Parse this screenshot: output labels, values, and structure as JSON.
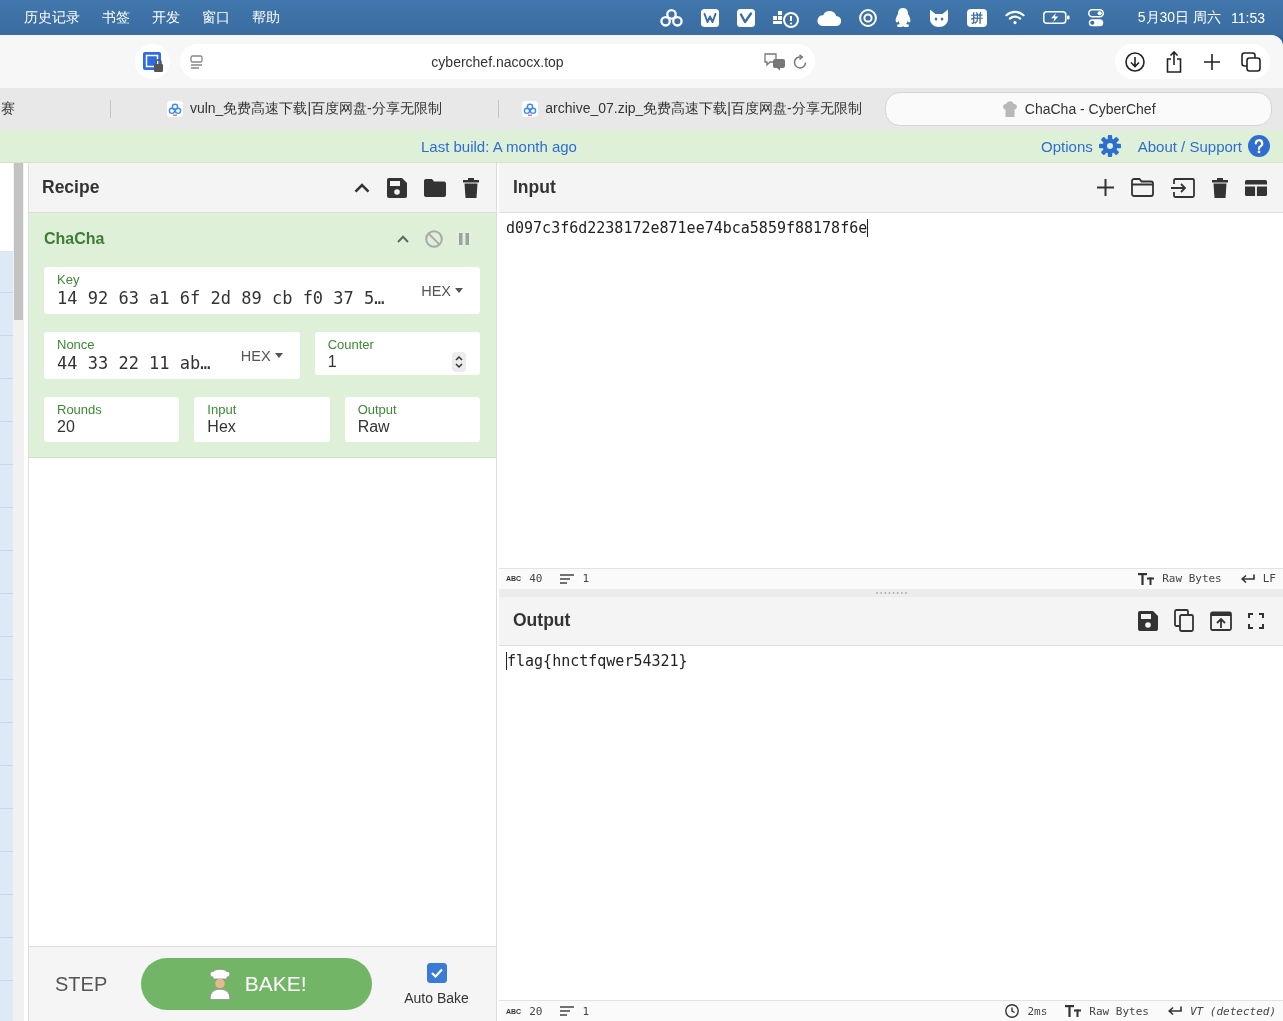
{
  "menu_bar": {
    "items": [
      "历史记录",
      "书签",
      "开发",
      "窗口",
      "帮助"
    ],
    "input_method": "拼",
    "date": "5月30日 周六",
    "time": "11:53"
  },
  "browser": {
    "address": "cyberchef.nacocx.top",
    "tabs": [
      {
        "title": "赛",
        "kind": "plain",
        "selected": false
      },
      {
        "title": "vuln_免费高速下载|百度网盘-分享无限制",
        "kind": "cloud",
        "selected": false
      },
      {
        "title": "archive_07.zip_免费高速下载|百度网盘-分享无限制",
        "kind": "cloud",
        "selected": false
      },
      {
        "title": "ChaCha - CyberChef",
        "kind": "chef",
        "selected": true
      }
    ]
  },
  "banner": {
    "last_build": "Last build: A month ago",
    "options": "Options",
    "about": "About / Support"
  },
  "recipe": {
    "title": "Recipe",
    "operation": {
      "name": "ChaCha",
      "arg_rows": [
        [
          {
            "kind": "hex",
            "label": "Key",
            "value": "14 92 63 a1 6f 2d 89 cb f0 37 5…",
            "format": "HEX"
          }
        ],
        [
          {
            "kind": "hex",
            "label": "Nonce",
            "value": "44 33 22 11 ab…",
            "format": "HEX"
          },
          {
            "kind": "number",
            "label": "Counter",
            "value": "1"
          }
        ],
        [
          {
            "kind": "option",
            "label": "Rounds",
            "value": "20"
          },
          {
            "kind": "option",
            "label": "Input",
            "value": "Hex"
          },
          {
            "kind": "option",
            "label": "Output",
            "value": "Raw"
          }
        ]
      ]
    },
    "controls": {
      "step": "STEP",
      "bake": "BAKE!",
      "auto_bake": {
        "label": "Auto Bake",
        "checked": true
      }
    }
  },
  "input": {
    "title": "Input",
    "text": "d097c3f6d2238172e871ee74bca5859f88178f6e",
    "status": {
      "length_icon": "ABC",
      "length": "40",
      "lines": "1",
      "format": "Raw Bytes",
      "eol": "LF"
    }
  },
  "output": {
    "title": "Output",
    "text": "flag{hnctfqwer54321}",
    "status": {
      "length_icon": "ABC",
      "length": "20",
      "lines": "1",
      "time": "2ms",
      "format": "Raw Bytes",
      "eol": "VT (detected)"
    }
  }
}
